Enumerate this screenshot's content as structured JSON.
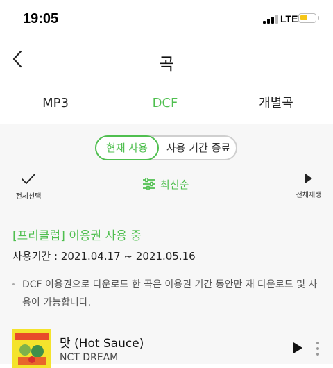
{
  "status": {
    "time": "19:05",
    "network": "LTE"
  },
  "header": {
    "title": "곡"
  },
  "tabs": [
    {
      "label": "MP3"
    },
    {
      "label": "DCF"
    },
    {
      "label": "개별곡"
    }
  ],
  "segment": {
    "active": "현재 사용",
    "inactive": "사용 기간 종료"
  },
  "toolbar": {
    "select_all": "전체선택",
    "sort": "최신순",
    "play_all": "전체재생"
  },
  "promo": {
    "title": "[프리클럽] 이용권 사용 중",
    "period": "사용기간 : 2021.04.17 ~ 2021.05.16",
    "notice": "DCF 이용권으로 다운로드 한 곡은 이용권 기간 동안만 재 다운로드 및 사용이 가능합니다."
  },
  "track": {
    "title": "맛 (Hot Sauce)",
    "artist": "NCT DREAM"
  },
  "colors": {
    "accent": "#4fbf4f",
    "battery": "#f5c518"
  }
}
